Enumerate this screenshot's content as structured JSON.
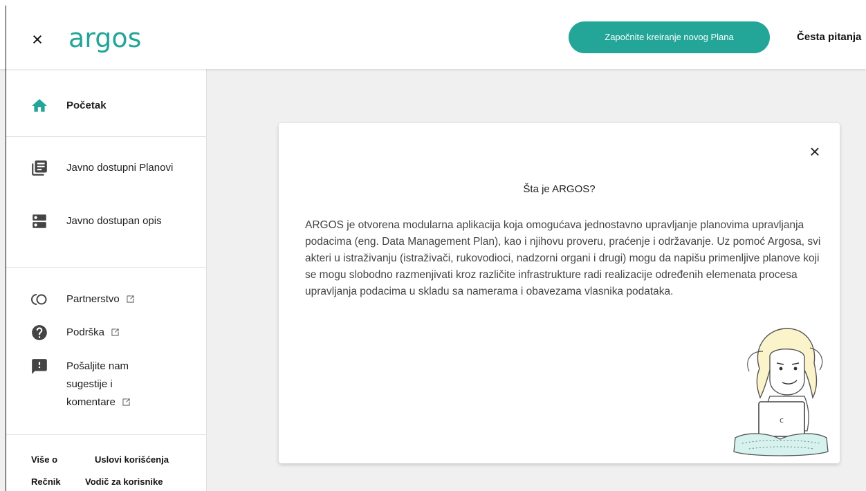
{
  "header": {
    "logo_text": "argos",
    "cta_label": "Započnite kreiranje novog Plana",
    "faq_label": "Česta pitanja"
  },
  "sidebar": {
    "home": {
      "label": "Početak",
      "icon": "home-icon"
    },
    "items": [
      {
        "label": "Javno dostupni Planovi",
        "icon": "library-books-icon"
      },
      {
        "label": "Javno dostupan opis",
        "icon": "dns-icon"
      }
    ],
    "links": [
      {
        "label": "Partnerstvo",
        "icon": "partnership-icon"
      },
      {
        "label": "Podrška",
        "icon": "help-icon"
      },
      {
        "label": "Pošaljite nam sugestije i komentare",
        "icon": "feedback-icon"
      }
    ],
    "footer": {
      "about": "Više o",
      "terms": "Uslovi korišćenja",
      "glossary": "Rečnik",
      "guide": "Vodič za korisnike"
    }
  },
  "dialog": {
    "title": "Šta je ARGOS?",
    "body": "ARGOS je otvorena modularna aplikacija koja omogućava jednostavno upravljanje planovima upravljanja podacima (eng. Data Management Plan), kao i njihovu proveru, praćenje i održavanje. Uz pomoć Argosa, svi akteri u istraživanju (istraživači, rukovodioci, nadzorni organi i drugi) mogu da napišu primenljive planove koji se mogu slobodno razmenjivati kroz različite infrastrukture radi realizacije određenih elemenata procesa upravljanja podacima u skladu sa namerama i obavezama vlasnika podataka."
  },
  "colors": {
    "accent": "#23a598",
    "logo": "#23a598",
    "background": "#f0f0f0"
  }
}
